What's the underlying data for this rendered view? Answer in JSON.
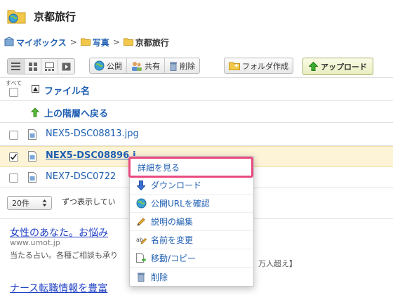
{
  "title": "京都旅行",
  "breadcrumb": {
    "root": "マイボックス",
    "parent": "写真",
    "current": "京都旅行",
    "sep": ">"
  },
  "toolbar": {
    "public_label": "公開",
    "share_label": "共有",
    "delete_label": "削除",
    "make_folder_label": "フォルダ作成",
    "upload_label": "アップロード"
  },
  "list": {
    "select_all_label": "すべて",
    "column_filename": "ファイル名",
    "up_level_label": "上の階層へ戻る",
    "files": [
      {
        "name": "NEX5-DSC08813.jpg",
        "checked": false
      },
      {
        "name": "NEX5-DSC08896.j",
        "checked": true
      },
      {
        "name": "NEX7-DSC0722",
        "checked": false
      }
    ]
  },
  "pagination": {
    "per_page_value": "20件",
    "per_page_text": "ずつ表示してい"
  },
  "ad": {
    "title": "女性のあなた。お悩み",
    "url": "www.umot.jp",
    "desc": "当たる占い。各種ご相談も承り",
    "desc_tail": "万人超え】",
    "title2": "ナース転職情報を豊富"
  },
  "context_menu": {
    "items": [
      {
        "label": "詳細を見る",
        "icon": "none"
      },
      {
        "label": "ダウンロード",
        "icon": "download-arrow-icon"
      },
      {
        "label": "公開URLを確認",
        "icon": "globe-icon"
      },
      {
        "label": "説明の編集",
        "icon": "pencil-icon"
      },
      {
        "label": "名前を変更",
        "icon": "rename-icon"
      },
      {
        "label": "移動/コピー",
        "icon": "move-copy-icon"
      },
      {
        "label": "削除",
        "icon": "trash-icon"
      }
    ]
  },
  "colors": {
    "link": "#1f5fb2",
    "selected_row": "#fdf3d6",
    "menu_highlight_border": "#e94b7f"
  }
}
